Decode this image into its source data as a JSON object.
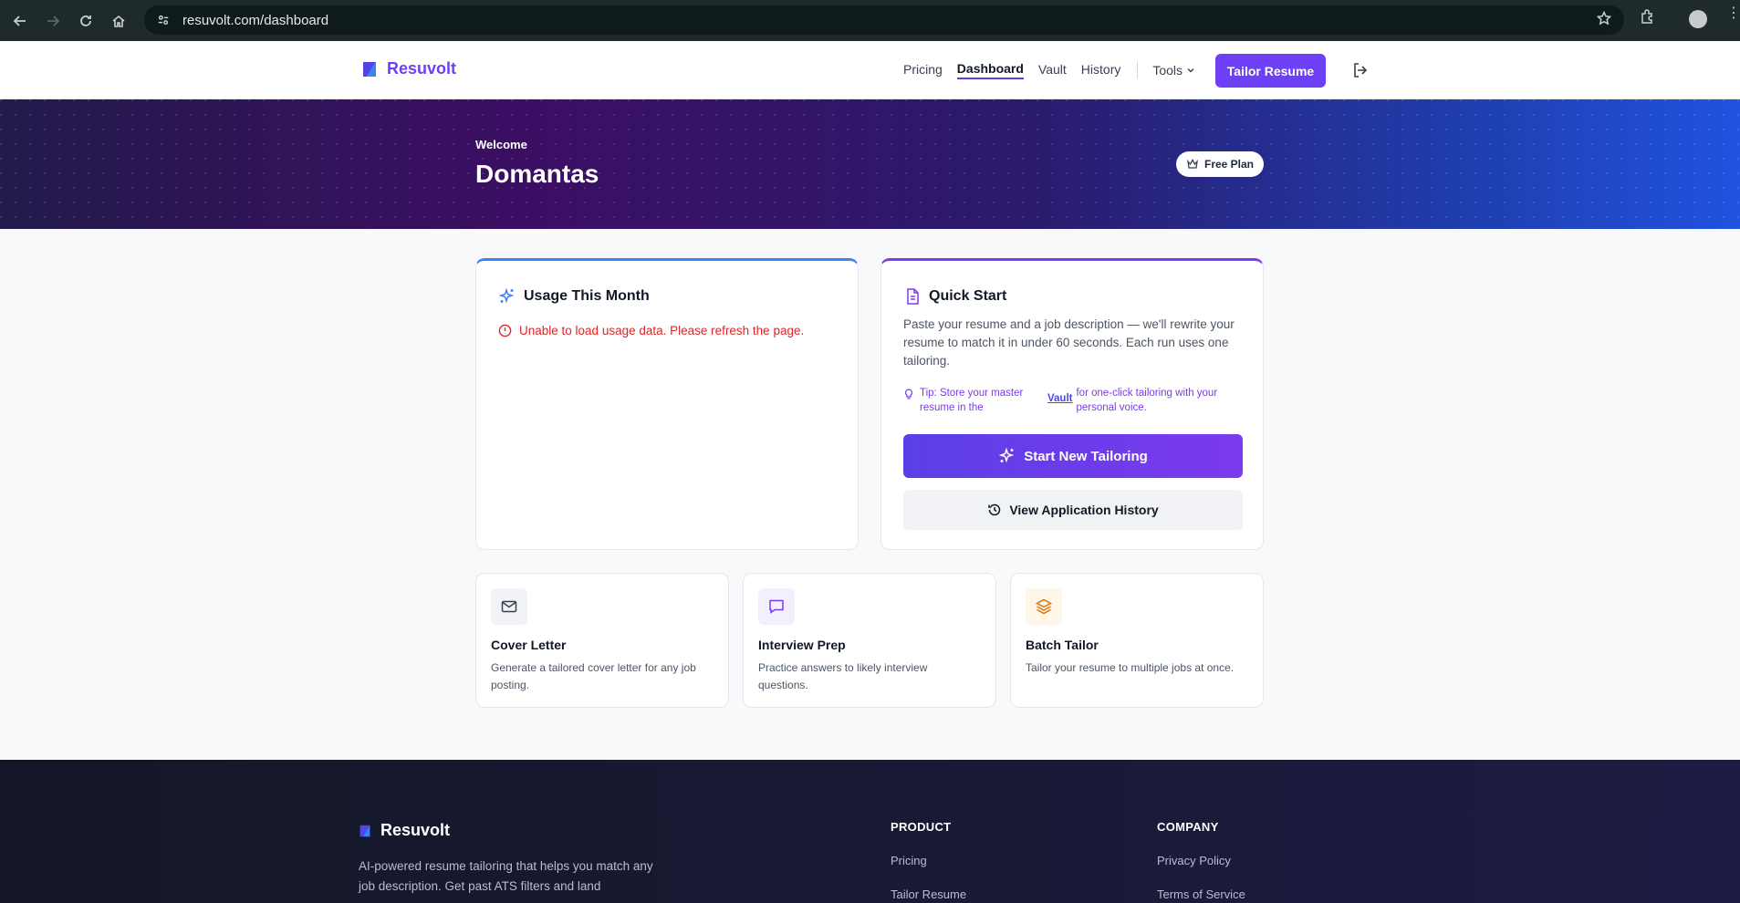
{
  "browser": {
    "url": "resuvolt.com/dashboard"
  },
  "header": {
    "brand": "Resuvolt",
    "nav": [
      "Pricing",
      "Dashboard",
      "Vault",
      "History"
    ],
    "tools_label": "Tools",
    "cta_label": "Tailor Resume"
  },
  "hero": {
    "welcome": "Welcome",
    "name": "Domantas",
    "plan": "Free Plan"
  },
  "usage": {
    "title": "Usage This Month",
    "error": "Unable to load usage data. Please refresh the page."
  },
  "quick_start": {
    "title": "Quick Start",
    "description": "Paste your resume and a job description — we'll rewrite your resume to match it in under 60 seconds. Each run uses one tailoring.",
    "tip_prefix": "Tip: Store your master resume in the",
    "tip_link": "Vault",
    "tip_suffix": "for one-click tailoring with your personal voice.",
    "primary_button": "Start New Tailoring",
    "secondary_button": "View Application History"
  },
  "tools": [
    {
      "title": "Cover Letter",
      "description": "Generate a tailored cover letter for any job posting.",
      "icon": "mail-icon",
      "color": "#374151",
      "bg": "#f1f3f6"
    },
    {
      "title": "Interview Prep",
      "description": "Practice answers to likely interview questions.",
      "icon": "chat-icon",
      "color": "#7c3aed",
      "bg": "#f3f0fd"
    },
    {
      "title": "Batch Tailor",
      "description": "Tailor your resume to multiple jobs at once.",
      "icon": "layers-icon",
      "color": "#d97706",
      "bg": "#fdf6e9"
    }
  ],
  "footer": {
    "brand": "Resuvolt",
    "description": "AI-powered resume tailoring that helps you match any job description. Get past ATS filters and land",
    "product_heading": "PRODUCT",
    "product_links": [
      "Pricing",
      "Tailor Resume"
    ],
    "company_heading": "COMPANY",
    "company_links": [
      "Privacy Policy",
      "Terms of Service"
    ]
  },
  "colors": {
    "brand": "#6d3ff5",
    "error": "#dc2626",
    "usage_accent": "#3b82f6",
    "quick_accent": "#7c3aed"
  }
}
